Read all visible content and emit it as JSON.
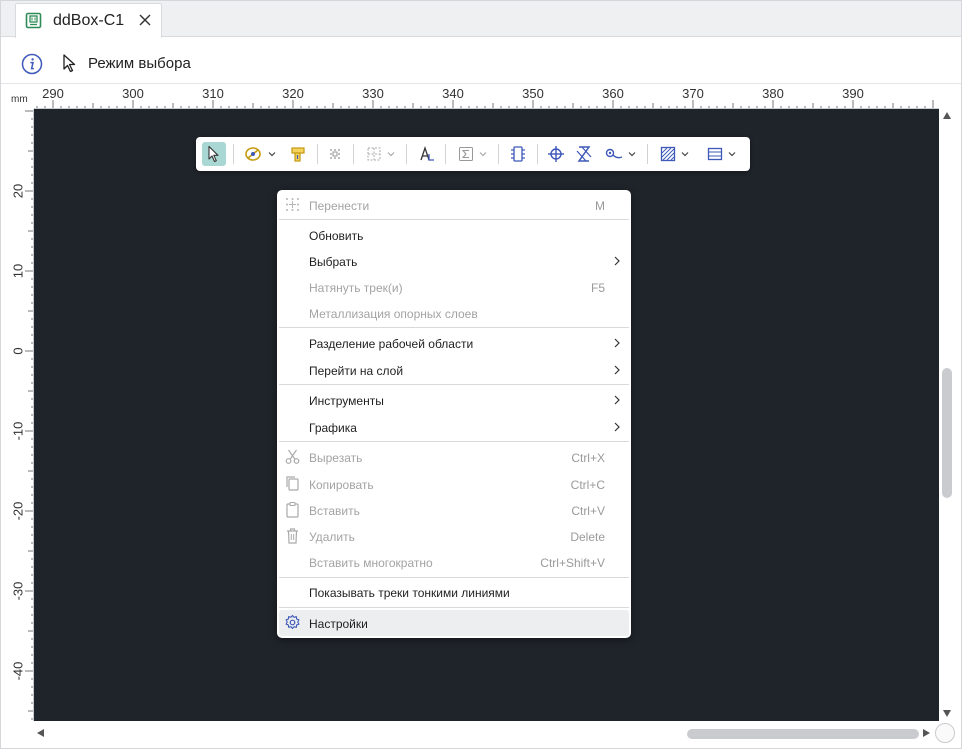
{
  "tab": {
    "title": "ddBox-C1",
    "icon": "board-icon",
    "close_icon": "close-icon"
  },
  "toolbar": {
    "info_icon": "info-icon",
    "mode_icon": "pointer-icon",
    "mode_label": "Режим выбора"
  },
  "ruler": {
    "unit": "mm",
    "top_labels": [
      "290",
      "300",
      "310",
      "320",
      "330",
      "340",
      "350",
      "360",
      "370",
      "380",
      "390"
    ],
    "left_labels": [
      "20",
      "10",
      "0",
      "-10",
      "-20",
      "-30",
      "-40"
    ]
  },
  "floating_toolbar": {
    "buttons": [
      "select-tool",
      "route-tool",
      "component-tool",
      "move-tool",
      "grid-tool",
      "text-tool",
      "sum-tool",
      "ic-tool",
      "crosshair-tool",
      "diff-pair-tool",
      "via-tool",
      "hatch-tool",
      "frame-tool"
    ]
  },
  "context_menu": {
    "items": [
      {
        "label": "Перенести",
        "shortcut": "M",
        "disabled": true,
        "icon": "move-icon"
      },
      {
        "label": "Обновить",
        "shortcut": "",
        "disabled": false
      },
      {
        "label": "Выбрать",
        "shortcut": "",
        "disabled": false,
        "submenu": true
      },
      {
        "label": "Натянуть трек(и)",
        "shortcut": "F5",
        "disabled": true
      },
      {
        "label": "Металлизация опорных слоев",
        "shortcut": "",
        "disabled": true
      },
      {
        "label": "Разделение рабочей области",
        "shortcut": "",
        "disabled": false,
        "submenu": true
      },
      {
        "label": "Перейти на слой",
        "shortcut": "",
        "disabled": false,
        "submenu": true
      },
      {
        "label": "Инструменты",
        "shortcut": "",
        "disabled": false,
        "submenu": true
      },
      {
        "label": "Графика",
        "shortcut": "",
        "disabled": false,
        "submenu": true
      },
      {
        "label": "Вырезать",
        "shortcut": "Ctrl+X",
        "disabled": true,
        "icon": "scissors-icon"
      },
      {
        "label": "Копировать",
        "shortcut": "Ctrl+C",
        "disabled": true,
        "icon": "copy-icon"
      },
      {
        "label": "Вставить",
        "shortcut": "Ctrl+V",
        "disabled": true,
        "icon": "paste-icon"
      },
      {
        "label": "Удалить",
        "shortcut": "Delete",
        "disabled": true,
        "icon": "trash-icon"
      },
      {
        "label": "Вставить многократно",
        "shortcut": "Ctrl+Shift+V",
        "disabled": true
      },
      {
        "label": "Показывать треки тонкими линиями",
        "shortcut": "",
        "disabled": false
      },
      {
        "label": "Настройки",
        "shortcut": "",
        "disabled": false,
        "icon": "gear-icon",
        "highlighted": true
      }
    ]
  },
  "colors": {
    "canvas": "#1f242a",
    "accent": "#3d58b8",
    "active_tool": "#a9d7d4",
    "gold": "#c49a10"
  }
}
